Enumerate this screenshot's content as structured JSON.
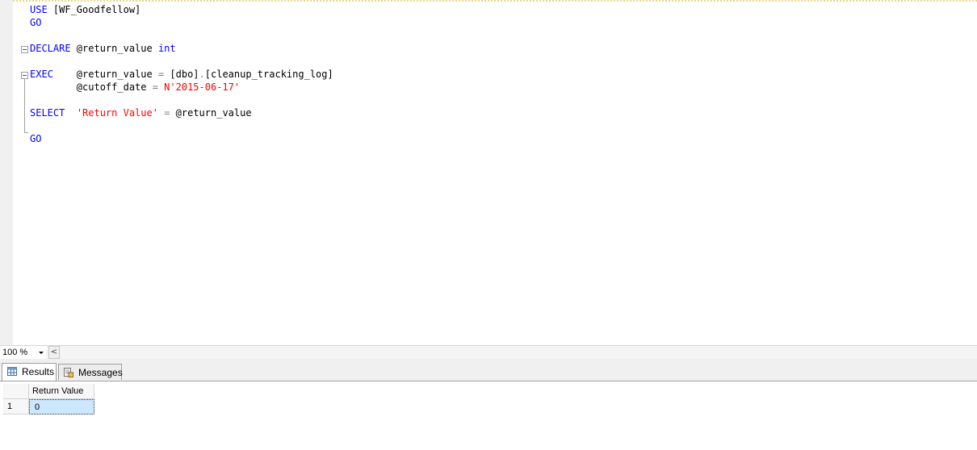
{
  "editor": {
    "lines": [
      {
        "parts": [
          {
            "t": "USE",
            "c": "kw"
          },
          {
            "t": " [WF_Goodfellow]",
            "c": ""
          }
        ]
      },
      {
        "parts": [
          {
            "t": "GO",
            "c": "kw"
          }
        ]
      },
      {
        "parts": []
      },
      {
        "parts": [
          {
            "t": "DECLARE",
            "c": "kw"
          },
          {
            "t": " @return_value ",
            "c": ""
          },
          {
            "t": "int",
            "c": "kw"
          }
        ]
      },
      {
        "parts": []
      },
      {
        "parts": [
          {
            "t": "EXEC",
            "c": "kw"
          },
          {
            "t": "    @return_value ",
            "c": ""
          },
          {
            "t": "=",
            "c": "op"
          },
          {
            "t": " [dbo]",
            "c": ""
          },
          {
            "t": ".",
            "c": "op"
          },
          {
            "t": "[cleanup_tracking_log]",
            "c": ""
          }
        ]
      },
      {
        "parts": [
          {
            "t": "        @cutoff_date ",
            "c": ""
          },
          {
            "t": "=",
            "c": "op"
          },
          {
            "t": " N'2015-06-17'",
            "c": "str"
          }
        ]
      },
      {
        "parts": []
      },
      {
        "parts": [
          {
            "t": "SELECT",
            "c": "kw"
          },
          {
            "t": "  ",
            "c": ""
          },
          {
            "t": "'Return Value'",
            "c": "str"
          },
          {
            "t": " ",
            "c": ""
          },
          {
            "t": "=",
            "c": "op"
          },
          {
            "t": " @return_value",
            "c": ""
          }
        ]
      },
      {
        "parts": []
      },
      {
        "parts": [
          {
            "t": "GO",
            "c": "kw"
          }
        ]
      }
    ]
  },
  "zoom": {
    "value": "100 %",
    "scroll_left_glyph": "<"
  },
  "tabs": {
    "results": "Results",
    "messages": "Messages"
  },
  "grid": {
    "column_header": "Return Value",
    "rows": [
      {
        "num": "1",
        "value": "0"
      }
    ]
  },
  "colors": {
    "keyword": "#0000ff",
    "string": "#ff0000",
    "operator": "#808080",
    "selection": "#cce8ff"
  },
  "icons": {
    "results_tab": "grid-icon",
    "messages_tab": "messages-icon",
    "zoom_dropdown": "chevron-down-icon"
  }
}
